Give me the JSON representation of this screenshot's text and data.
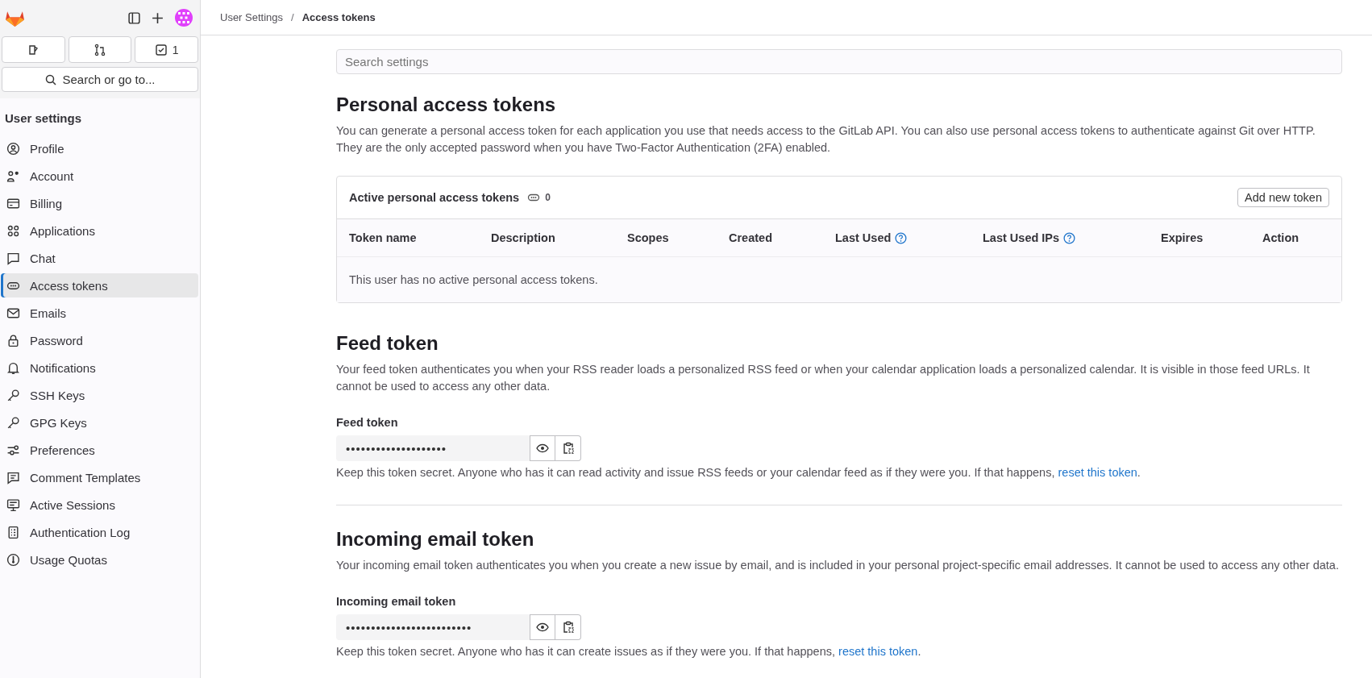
{
  "sidebar": {
    "todo_count": "1",
    "search": {
      "label": "Search or go to..."
    },
    "section_title": "User settings",
    "items": [
      {
        "label": "Profile",
        "selected": false
      },
      {
        "label": "Account",
        "selected": false
      },
      {
        "label": "Billing",
        "selected": false
      },
      {
        "label": "Applications",
        "selected": false
      },
      {
        "label": "Chat",
        "selected": false
      },
      {
        "label": "Access tokens",
        "selected": true
      },
      {
        "label": "Emails",
        "selected": false
      },
      {
        "label": "Password",
        "selected": false
      },
      {
        "label": "Notifications",
        "selected": false
      },
      {
        "label": "SSH Keys",
        "selected": false
      },
      {
        "label": "GPG Keys",
        "selected": false
      },
      {
        "label": "Preferences",
        "selected": false
      },
      {
        "label": "Comment Templates",
        "selected": false
      },
      {
        "label": "Active Sessions",
        "selected": false
      },
      {
        "label": "Authentication Log",
        "selected": false
      },
      {
        "label": "Usage Quotas",
        "selected": false
      }
    ]
  },
  "breadcrumbs": [
    {
      "label": "User Settings",
      "current": false
    },
    {
      "separator": "/",
      "label": "Access tokens",
      "current": true
    }
  ],
  "search_settings": {
    "placeholder": "Search settings"
  },
  "personal_tokens": {
    "title": "Personal access tokens",
    "description": "You can generate a personal access token for each application you use that needs access to the GitLab API. You can also use personal access tokens to authenticate against Git over HTTP. They are the only accepted password when you have Two-Factor Authentication (2FA) enabled.",
    "card": {
      "title": "Active personal access tokens",
      "count": "0",
      "button": "Add new token",
      "columns": [
        {
          "label": "Token name",
          "help": false
        },
        {
          "label": "Description",
          "help": false
        },
        {
          "label": "Scopes",
          "help": false
        },
        {
          "label": "Created",
          "help": false
        },
        {
          "label": "Last Used",
          "help": true
        },
        {
          "label": "Last Used IPs",
          "help": true
        },
        {
          "label": "Expires",
          "help": false
        },
        {
          "label": "Action",
          "help": false
        }
      ],
      "empty_message": "This user has no active personal access tokens."
    }
  },
  "sections": [
    {
      "title": "Feed token",
      "description": "Your feed token authenticates you when your RSS reader loads a personalized RSS feed or when your calendar application loads a personalized calendar. It is visible in those feed URLs. It cannot be used to access any other data.",
      "field_label": "Feed token",
      "value": "••••••••••••••••••••",
      "help_text": "Keep this token secret. Anyone who has it can read activity and issue RSS feeds or your calendar feed as if they were you. If that happens, ",
      "link": "reset this token",
      "after": "."
    },
    {
      "title": "Incoming email token",
      "description": "Your incoming email token authenticates you when you create a new issue by email, and is included in your personal project-specific email addresses. It cannot be used to access any other data.",
      "field_label": "Incoming email token",
      "value": "•••••••••••••••••••••••••",
      "help_text": "Keep this token secret. Anyone who has it can create issues as if they were you. If that happens, ",
      "link": "reset this token",
      "after": "."
    }
  ]
}
